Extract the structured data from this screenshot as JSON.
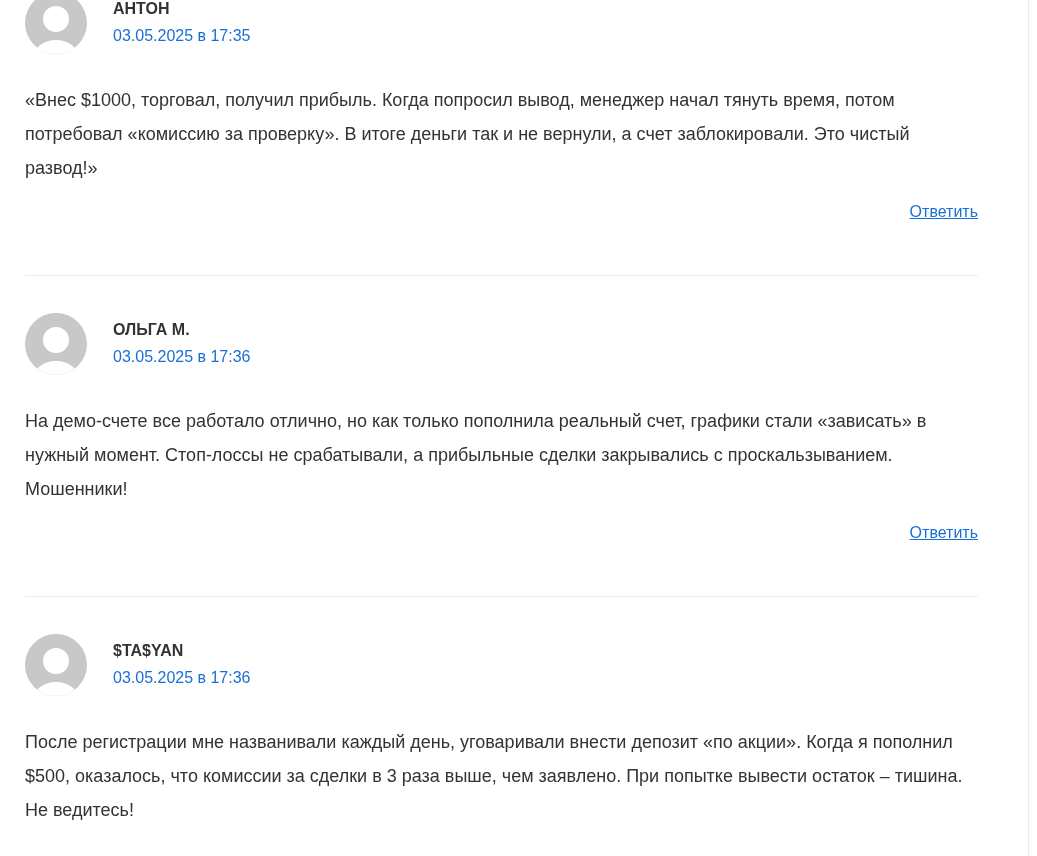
{
  "comments": [
    {
      "author": "АНТОН",
      "date": "03.05.2025 в 17:35",
      "text": "«Внес $1000, торговал, получил прибыль. Когда попросил вывод, менеджер начал тянуть время, потом потребовал «комиссию за проверку». В итоге деньги так и не вернули, а счет заблокировали. Это чистый развод!»",
      "reply": "Ответить"
    },
    {
      "author": "ОЛЬГА М.",
      "date": "03.05.2025 в 17:36",
      "text": "На демо-счете все работало отлично, но как только пополнила реальный счет, графики стали «зависать» в нужный момент. Стоп-лоссы не срабатывали, а прибыльные сделки закрывались с проскальзыванием. Мошенники!",
      "reply": "Ответить"
    },
    {
      "author": "$TA$YAN",
      "date": "03.05.2025 в 17:36",
      "text": "После регистрации мне названивали каждый день, уговаривали внести депозит «по акции». Когда я пополнил $500, оказалось, что комиссии за сделки в 3 раза выше, чем заявлено. При попытке вывести остаток – тишина. Не ведитесь!"
    }
  ]
}
